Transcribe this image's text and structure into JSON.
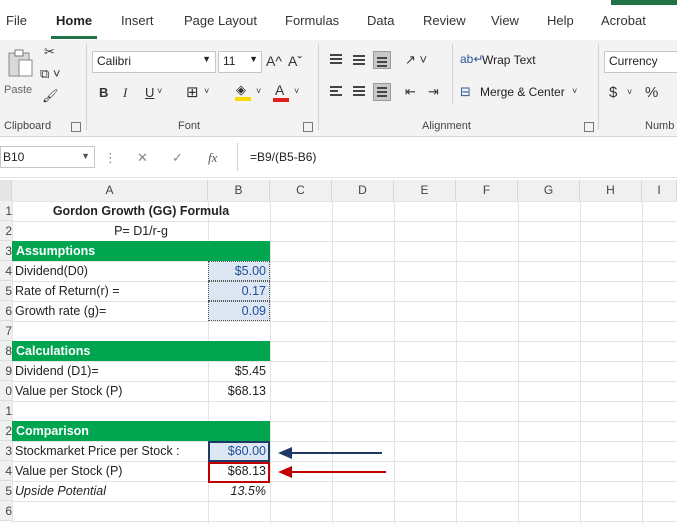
{
  "menu": {
    "tabs": [
      "File",
      "Home",
      "Insert",
      "Page Layout",
      "Formulas",
      "Data",
      "Review",
      "View",
      "Help",
      "Acrobat"
    ],
    "active": "Home"
  },
  "ribbon": {
    "clipboard": {
      "paste_label": "Paste",
      "group_label": "Clipboard"
    },
    "font": {
      "font_name": "Calibri",
      "font_size": "11",
      "grow_label": "A^",
      "shrink_label": "Aˇ",
      "bold": "B",
      "italic": "I",
      "underline": "U",
      "font_color_glyph": "A",
      "group_label": "Font",
      "font_color_hex": "#e0201b",
      "highlight_hex": "#ffd800"
    },
    "alignment": {
      "wrap_label": "Wrap Text",
      "merge_label": "Merge & Center",
      "group_label": "Alignment"
    },
    "number": {
      "format": "Currency",
      "dollar": "$",
      "percent": "%",
      "group_label": "Numb"
    }
  },
  "formula_bar": {
    "name_box": "B10",
    "fx": "fx",
    "formula": "=B9/(B5-B6)"
  },
  "grid": {
    "columns": [
      "A",
      "B",
      "C",
      "D",
      "E",
      "F",
      "G",
      "H",
      "I"
    ],
    "rows": [
      "1",
      "2",
      "3",
      "4",
      "5",
      "6",
      "7",
      "8",
      "9",
      "0",
      "1",
      "2",
      "3",
      "4",
      "5",
      "6"
    ],
    "accent_green": "#00a550",
    "cells": {
      "title": "Gordon Growth (GG) Formula",
      "formula_text": "P= D1/r-g",
      "assumptions_header": "Assumptions",
      "dividend_d0_label": "Dividend(D0)",
      "dividend_d0_value": "$5.00",
      "rate_of_return_label": "Rate of Return(r) =",
      "rate_of_return_value": "0.17",
      "growth_rate_label": "Growth rate (g)=",
      "growth_rate_value": "0.09",
      "calculations_header": "Calculations",
      "dividend_d1_label": "Dividend (D1)=",
      "dividend_d1_value": "$5.45",
      "value_per_stock_label": "Value per Stock (P)",
      "value_per_stock_value": "$68.13",
      "comparison_header": "Comparison",
      "market_price_label": "Stockmarket Price per Stock :",
      "market_price_value": "$60.00",
      "value_per_stock2_label": "Value per Stock (P)",
      "value_per_stock2_value": "$68.13",
      "upside_label": "Upside Potential",
      "upside_value": "13.5%"
    },
    "arrow_blue_hex": "#1f3864",
    "arrow_red_hex": "#c00000"
  }
}
